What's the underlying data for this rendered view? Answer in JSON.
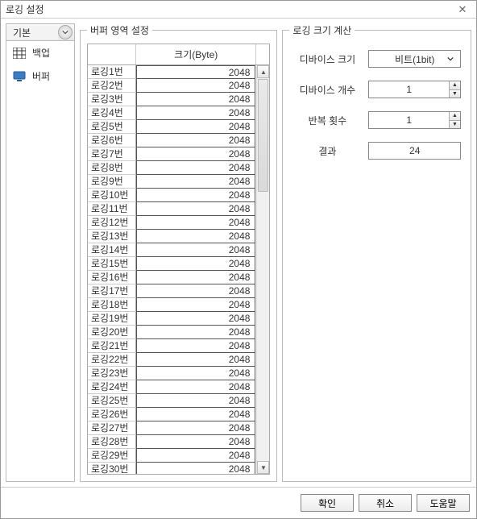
{
  "window": {
    "title": "로깅 설정",
    "close_glyph": "✕"
  },
  "sidebar": {
    "tab_label": "기본",
    "items": [
      {
        "label": "백업",
        "icon": "grid"
      },
      {
        "label": "버퍼",
        "icon": "display"
      }
    ]
  },
  "buffer_area": {
    "legend": "버퍼 영역 설정",
    "columns": {
      "rowhead": "",
      "size": "크기(Byte)"
    },
    "rows": [
      {
        "name": "로깅1번",
        "size": 2048
      },
      {
        "name": "로깅2번",
        "size": 2048
      },
      {
        "name": "로깅3번",
        "size": 2048
      },
      {
        "name": "로깅4번",
        "size": 2048
      },
      {
        "name": "로깅5번",
        "size": 2048
      },
      {
        "name": "로깅6번",
        "size": 2048
      },
      {
        "name": "로깅7번",
        "size": 2048
      },
      {
        "name": "로깅8번",
        "size": 2048
      },
      {
        "name": "로깅9번",
        "size": 2048
      },
      {
        "name": "로깅10번",
        "size": 2048
      },
      {
        "name": "로깅11번",
        "size": 2048
      },
      {
        "name": "로깅12번",
        "size": 2048
      },
      {
        "name": "로깅13번",
        "size": 2048
      },
      {
        "name": "로깅14번",
        "size": 2048
      },
      {
        "name": "로깅15번",
        "size": 2048
      },
      {
        "name": "로깅16번",
        "size": 2048
      },
      {
        "name": "로깅17번",
        "size": 2048
      },
      {
        "name": "로깅18번",
        "size": 2048
      },
      {
        "name": "로깅19번",
        "size": 2048
      },
      {
        "name": "로깅20번",
        "size": 2048
      },
      {
        "name": "로깅21번",
        "size": 2048
      },
      {
        "name": "로깅22번",
        "size": 2048
      },
      {
        "name": "로깅23번",
        "size": 2048
      },
      {
        "name": "로깅24번",
        "size": 2048
      },
      {
        "name": "로깅25번",
        "size": 2048
      },
      {
        "name": "로깅26번",
        "size": 2048
      },
      {
        "name": "로깅27번",
        "size": 2048
      },
      {
        "name": "로깅28번",
        "size": 2048
      },
      {
        "name": "로깅29번",
        "size": 2048
      },
      {
        "name": "로깅30번",
        "size": 2048
      }
    ]
  },
  "calc": {
    "legend": "로깅 크기 계산",
    "device_size_label": "디바이스 크기",
    "device_size_value": "비트(1bit)",
    "device_count_label": "디바이스 개수",
    "device_count_value": 1,
    "repeat_label": "반복 횟수",
    "repeat_value": 1,
    "result_label": "결과",
    "result_value": 24
  },
  "footer": {
    "ok": "확인",
    "cancel": "취소",
    "help": "도움말"
  }
}
